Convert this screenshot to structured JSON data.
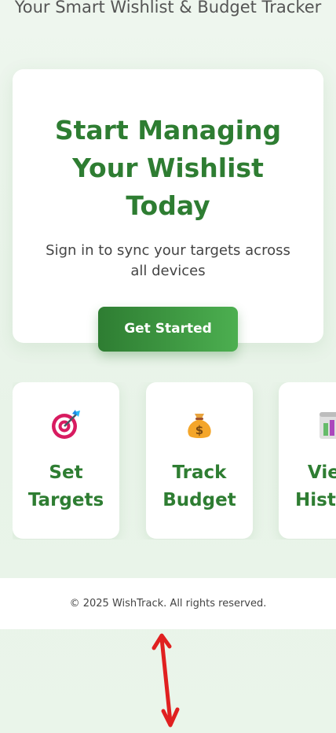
{
  "header": {
    "tagline": "Your Smart Wishlist & Budget Tracker"
  },
  "hero": {
    "title": "Start Managing Your Wishlist Today",
    "subtitle": "Sign in to sync your targets across all devices",
    "cta_label": "Get Started"
  },
  "features": [
    {
      "label": "Set\nTargets",
      "icon": "target-icon"
    },
    {
      "label": "Track\nBudget",
      "icon": "money-bag-icon"
    },
    {
      "label": "View\nHistory",
      "icon": "chart-icon"
    }
  ],
  "footer": {
    "copyright": "© 2025 WishTrack. All rights reserved."
  },
  "colors": {
    "brand_green": "#2e7d32",
    "brand_green_light": "#4caf50",
    "annotation_red": "#e02020"
  }
}
